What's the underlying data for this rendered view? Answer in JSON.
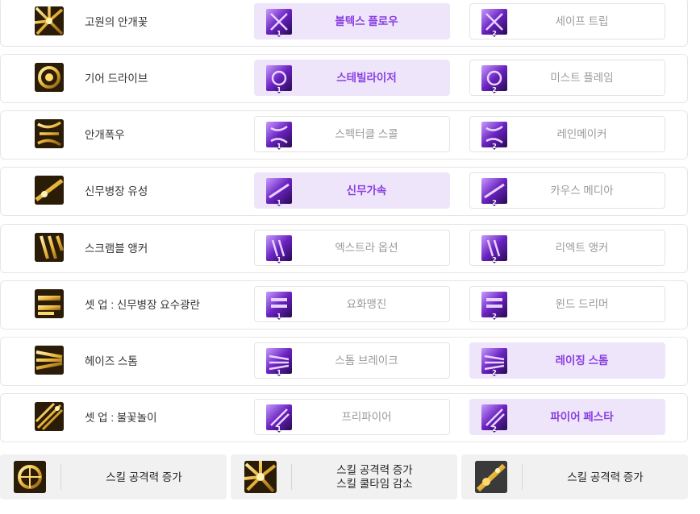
{
  "rows": [
    {
      "skill": "고원의 안개꽃",
      "icon": "sunburst-skill-icon",
      "opt1": "볼텍스 플로우",
      "opt2": "세이프 트립",
      "selected": 1
    },
    {
      "skill": "기어 드라이브",
      "icon": "gear-skill-icon",
      "opt1": "스테빌라이저",
      "opt2": "미스트 플레임",
      "selected": 1
    },
    {
      "skill": "안개폭우",
      "icon": "storm-skill-icon",
      "opt1": "스펙터클 스콜",
      "opt2": "레인메이커",
      "selected": 0
    },
    {
      "skill": "신무병장 유성",
      "icon": "blade-skill-icon",
      "opt1": "신무가속",
      "opt2": "카우스 메디아",
      "selected": 1
    },
    {
      "skill": "스크램블 앵커",
      "icon": "anchor-skill-icon",
      "opt1": "엑스트라 옵션",
      "opt2": "리엑트 앵커",
      "selected": 0
    },
    {
      "skill": "셋 업 : 신무병장 요수광란",
      "icon": "setup-skill-icon",
      "opt1": "요화맹진",
      "opt2": "윈드 드리머",
      "selected": 0
    },
    {
      "skill": "헤이즈 스톰",
      "icon": "haze-skill-icon",
      "opt1": "스톰 브레이크",
      "opt2": "레이징 스톰",
      "selected": 2
    },
    {
      "skill": "셋 업 : 불꽃놀이",
      "icon": "firework-skill-icon",
      "opt1": "프리파이어",
      "opt2": "파이어 페스타",
      "selected": 2
    }
  ],
  "option_badges": {
    "first": "1",
    "second": "2"
  },
  "bottom": [
    {
      "icon": "ring-skill-icon",
      "lines": [
        "스킬 공격력 증가"
      ]
    },
    {
      "icon": "burst-skill-icon",
      "lines": [
        "스킬 공격력 증가",
        "스킬 쿨타임 감소"
      ]
    },
    {
      "icon": "cannon-skill-icon",
      "lines": [
        "스킬 공격력 증가"
      ]
    }
  ],
  "colors": {
    "selected_bg": "#eee5fb",
    "selected_text": "#8a3fe0",
    "muted_text": "#9a9a9a",
    "gold": "#e9b43a",
    "purple": "#5b1f9e"
  }
}
